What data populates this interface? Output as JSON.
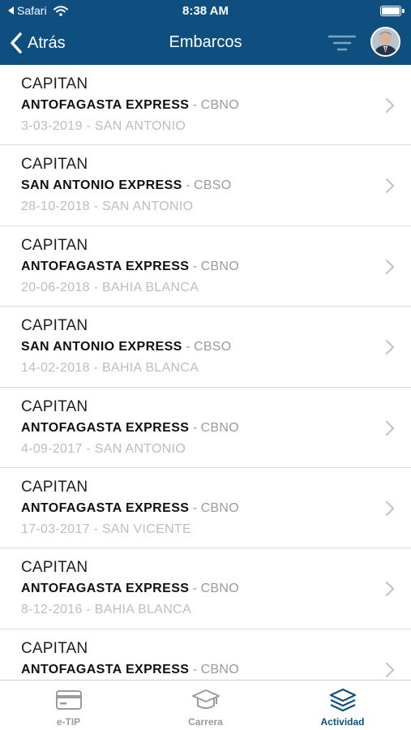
{
  "status_bar": {
    "back_app": "Safari",
    "time": "8:38 AM"
  },
  "nav": {
    "back_label": "Atrás",
    "title": "Embarcos"
  },
  "colors": {
    "nav_background": "#0f4f80",
    "active_tab": "#0f4f80",
    "inactive_tab": "#9b9b9b",
    "secondary_text": "#9a9a9a",
    "tertiary_text": "#bdbdbd"
  },
  "icons": {
    "back": "chevron-left-icon",
    "filter": "filter-icon",
    "row_disclosure": "chevron-right-icon",
    "tab_etip": "card-icon",
    "tab_carrera": "graduation-cap-icon",
    "tab_actividad": "layers-icon"
  },
  "embarcos": [
    {
      "role": "CAPITAN",
      "vessel": "ANTOFAGASTA EXPRESS",
      "sep": " - ",
      "code": "CBNO",
      "date_place": "3-03-2019 - SAN ANTONIO"
    },
    {
      "role": "CAPITAN",
      "vessel": "SAN ANTONIO EXPRESS",
      "sep": " - ",
      "code": "CBSO",
      "date_place": "28-10-2018 - SAN ANTONIO"
    },
    {
      "role": "CAPITAN",
      "vessel": "ANTOFAGASTA EXPRESS",
      "sep": " - ",
      "code": "CBNO",
      "date_place": "20-06-2018 - BAHIA BLANCA"
    },
    {
      "role": "CAPITAN",
      "vessel": "SAN ANTONIO EXPRESS",
      "sep": " - ",
      "code": "CBSO",
      "date_place": "14-02-2018 - BAHIA BLANCA"
    },
    {
      "role": "CAPITAN",
      "vessel": "ANTOFAGASTA EXPRESS",
      "sep": " - ",
      "code": "CBNO",
      "date_place": "4-09-2017 - SAN ANTONIO"
    },
    {
      "role": "CAPITAN",
      "vessel": "ANTOFAGASTA EXPRESS",
      "sep": " - ",
      "code": "CBNO",
      "date_place": "17-03-2017 - SAN VICENTE"
    },
    {
      "role": "CAPITAN",
      "vessel": "ANTOFAGASTA EXPRESS",
      "sep": " - ",
      "code": "CBNO",
      "date_place": "8-12-2016 - BAHIA BLANCA"
    },
    {
      "role": "CAPITAN",
      "vessel": "ANTOFAGASTA EXPRESS",
      "sep": " - ",
      "code": "CBNO",
      "date_place": ""
    }
  ],
  "tabs": [
    {
      "label": "e-TIP",
      "active": false
    },
    {
      "label": "Carrera",
      "active": false
    },
    {
      "label": "Actividad",
      "active": true
    }
  ]
}
